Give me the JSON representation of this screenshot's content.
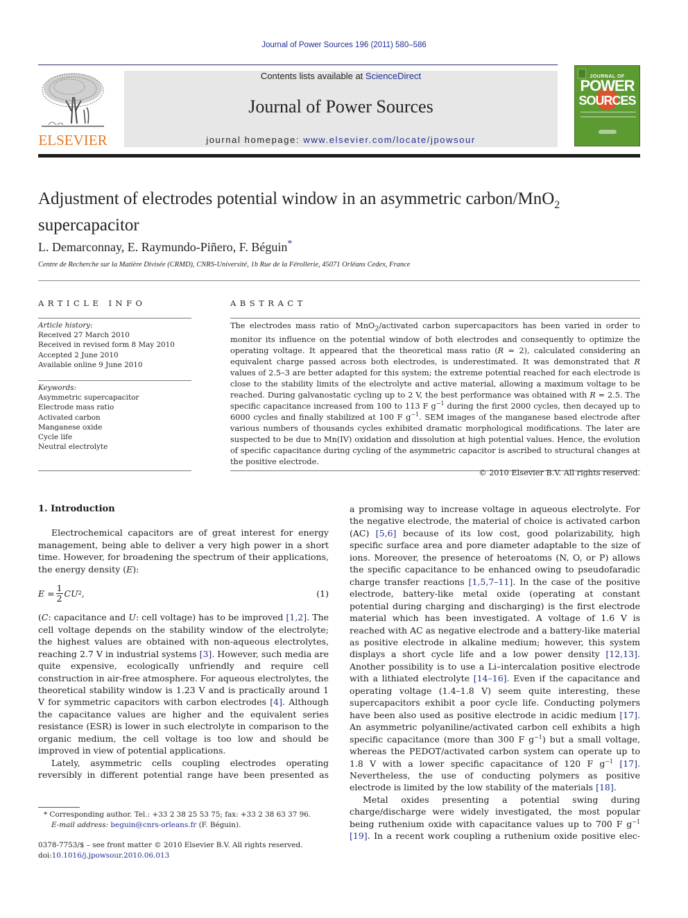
{
  "header": {
    "journal_ref": "Journal of Power Sources 196 (2011) 580–586",
    "contents_prefix": "Contents lists available at ",
    "contents_link": "ScienceDirect",
    "journal_title": "Journal of Power Sources",
    "homepage_prefix": "journal homepage: ",
    "homepage_link": "www.elsevier.com/locate/jpowsour",
    "publisher_logo_text": "ELSEVIER",
    "cover": {
      "top": "JOURNAL OF",
      "power": "POWER",
      "sources": "SOURCES"
    },
    "colors": {
      "link": "#1f2f8f",
      "elsevier_orange": "#e87722",
      "cover_green": "#5c9a32",
      "cover_orange": "#d9542b"
    }
  },
  "article": {
    "title_part1": "Adjustment of electrodes potential window in an asymmetric carbon/MnO",
    "title_sub": "2",
    "title_part2": "supercapacitor",
    "authors": "L. Demarconnay, E. Raymundo-Piñero, F. Béguin",
    "corresponding_mark": "*",
    "affiliation": "Centre de Recherche sur la Matière Divisée (CRMD), CNRS-Université, 1b Rue de la Férollerie, 45071 Orléans Cedex, France"
  },
  "article_info": {
    "heading": "ARTICLE INFO",
    "history_label": "Article history:",
    "history": [
      "Received 27 March 2010",
      "Received in revised form 8 May 2010",
      "Accepted 2 June 2010",
      "Available online 9 June 2010"
    ],
    "keywords_label": "Keywords:",
    "keywords": [
      "Asymmetric supercapacitor",
      "Electrode mass ratio",
      "Activated carbon",
      "Manganese oxide",
      "Cycle life",
      "Neutral electrolyte"
    ]
  },
  "abstract": {
    "heading": "ABSTRACT",
    "s1a": "The electrodes mass ratio of MnO",
    "s1b": "2",
    "s1c": "/activated carbon supercapacitors has been varied in order to monitor its influence on the potential window of both electrodes and consequently to optimize the operating voltage. It appeared that the theoretical mass ratio (",
    "r1": "R",
    "s2": " = 2), calculated considering an equivalent charge passed across both electrodes, is underestimated. It was demonstrated that ",
    "r2": "R",
    "s3": " values of 2.5–3 are better adapted for this system; the extreme potential reached for each electrode is close to the stability limits of the electrolyte and active material, allowing a maximum voltage to be reached. During galvanostatic cycling up to 2 V, the best performance was obtained with ",
    "r3": "R",
    "s4": " = 2.5. The specific capacitance increased from 100 to 113 F g",
    "sup1": "−1",
    "s5": " during the first 2000 cycles, then decayed up to 6000 cycles and finally stabilized at 100 F g",
    "sup2": "−1",
    "s6": ". SEM images of the manganese based electrode after various numbers of thousands cycles exhibited dramatic morphological modifications. The later are suspected to be due to Mn(IV) oxidation and dissolution at high potential values. Hence, the evolution of specific capacitance during cycling of the asymmetric capacitor is ascribed to structural changes at the positive electrode.",
    "copyright": "© 2010 Elsevier B.V. All rights reserved."
  },
  "body": {
    "section_heading": "1.  Introduction",
    "left": {
      "p1": "Electrochemical capacitors are of great interest for energy management, being able to deliver a very high power in a short time. However, for broadening the spectrum of their applications, the energy density (",
      "p1_var": "E",
      "p1_end": "):",
      "eq_lhs": "E = ",
      "eq_num": "1",
      "eq_den": "2",
      "eq_rhs": "CU",
      "eq_exp": "2",
      "eq_tail": ",",
      "eq_label": "(1)",
      "p2_a": "(",
      "p2_c": "C",
      "p2_b": ": capacitance and ",
      "p2_u": "U",
      "p2_d": ": cell voltage) has to be improved ",
      "ref_1_2": "[1,2]",
      "p2_e": ". The cell voltage depends on the stability window of the electrolyte; the highest values are obtained with non-aqueous electrolytes, reaching 2.7 V in industrial systems ",
      "ref_3": "[3]",
      "p2_f": ". However, such media are quite expensive, ecologically unfriendly and require cell construction in air-free atmosphere. For aqueous electrolytes, the theoretical stability window is 1.23 V and is practically around 1 V for symmetric capacitors with carbon electrodes ",
      "ref_4": "[4]",
      "p2_g": ". Although the capacitance values are higher and the equivalent series resistance (ESR) is lower in such electrolyte in comparison to the organic medium, the cell voltage is too low and should be improved in view of potential applications.",
      "p3": "Lately, asymmetric cells coupling electrodes operating reversibly in different potential range have been presented as"
    },
    "right": {
      "a": "a promising way to increase voltage in aqueous electrolyte. For the negative electrode, the material of choice is activated carbon (AC) ",
      "ref_5_6": "[5,6]",
      "b": " because of its low cost, good polarizability, high specific surface area and pore diameter adaptable to the size of ions. Moreover, the presence of heteroatoms (N, O, or P) allows the specific capacitance to be enhanced owing to pseudofaradic charge transfer reactions ",
      "ref_1_5_7_11": "[1,5,7–11]",
      "c": ". In the case of the positive electrode, battery-like metal oxide (operating at constant potential during charging and discharging) is the first electrode material which has been investigated. A voltage of 1.6 V is reached with AC as negative electrode and a battery-like material as positive electrode in alkaline medium; however, this system displays a short cycle life and a low power density ",
      "ref_12_13": "[12,13]",
      "d": ". Another possibility is to use a Li–intercalation positive electrode with a lithiated electrolyte ",
      "ref_14_16": "[14–16]",
      "e": ". Even if the capacitance and operating voltage (1.4–1.8 V) seem quite interesting, these supercapacitors exhibit a poor cycle life. Conducting polymers have been also used as positive electrode in acidic medium ",
      "ref_17a": "[17]",
      "f": ". An asymmetric polyaniline/activated carbon cell exhibits a high specific capacitance (more than 300 F g",
      "sup_a": "−1",
      "g": ") but a small voltage, whereas the PEDOT/activated carbon system can operate up to 1.8 V with a lower specific capacitance of 120 F g",
      "sup_b": "−1",
      "h": " ",
      "ref_17b": "[17]",
      "i": ". Nevertheless, the use of conducting polymers as positive electrode is limited by the low stability of the materials ",
      "ref_18": "[18]",
      "j": ".",
      "p2_a": "Metal oxides presenting a potential swing during charge/discharge were widely investigated, the most popular being ruthenium oxide with capacitance values up to 700 F g",
      "sup_c": "−1",
      "p2_b": " ",
      "ref_19": "[19]",
      "p2_c": ". In a recent work coupling a ruthenium oxide positive elec-"
    }
  },
  "footnote": {
    "mark": "*",
    "text": " Corresponding author. Tel.: +33 2 38 25 53 75; fax: +33 2 38 63 37 96.",
    "email_label": "E-mail address:",
    "email": "beguin@cnrs-orleans.fr",
    "email_suffix": " (F. Béguin)."
  },
  "footer": {
    "issn_line": "0378-7753/$ – see front matter © 2010 Elsevier B.V. All rights reserved.",
    "doi_label": "doi:",
    "doi": "10.1016/j.jpowsour.2010.06.013"
  }
}
